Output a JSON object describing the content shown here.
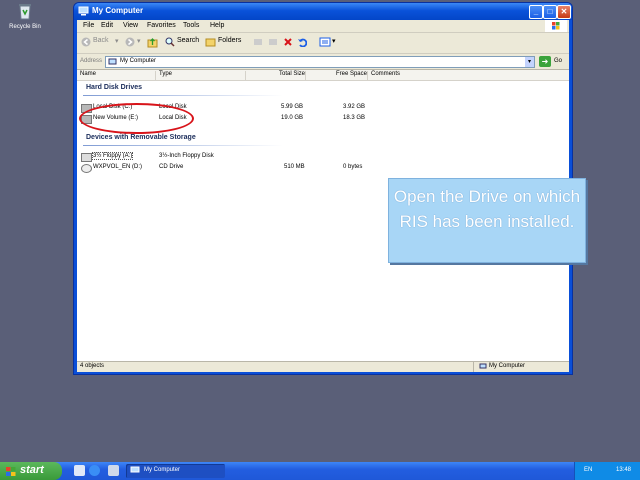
{
  "desktop": {
    "recycle_bin_label": "Recycle Bin"
  },
  "window": {
    "title": "My Computer",
    "controls": {
      "minimize": "_",
      "maximize": "□",
      "close": "✕"
    },
    "menu": [
      "File",
      "Edit",
      "View",
      "Favorites",
      "Tools",
      "Help"
    ],
    "toolbar": {
      "back": "Back",
      "search": "Search",
      "folders": "Folders"
    },
    "address": {
      "label": "Address",
      "value": "My Computer",
      "go": "Go"
    },
    "columns": {
      "name": "Name",
      "type": "Type",
      "total": "Total Size",
      "free": "Free Space",
      "comments": "Comments"
    },
    "groups": {
      "hard": "Hard Disk Drives",
      "removable": "Devices with Removable Storage"
    },
    "drives": [
      {
        "name": "Local Disk (C:)",
        "type": "Local Disk",
        "total": "5.99 GB",
        "free": "3.92 GB"
      },
      {
        "name": "New Volume (E:)",
        "type": "Local Disk",
        "total": "19.0 GB",
        "free": "18.3 GB"
      }
    ],
    "removable": [
      {
        "name": "3½ Floppy (A:)",
        "type": "3½-Inch Floppy Disk",
        "total": "",
        "free": ""
      },
      {
        "name": "WXPVOL_EN (D:)",
        "type": "CD Drive",
        "total": "510 MB",
        "free": "0 bytes"
      }
    ],
    "status": {
      "objects": "4 objects",
      "location": "My Computer"
    }
  },
  "callout": {
    "text": "Open the Drive on which RIS has been installed."
  },
  "taskbar": {
    "start": "start",
    "task": "My Computer",
    "lang": "EN",
    "time": "13:48"
  },
  "colors": {
    "xp_blue": "#0a52d9",
    "highlight": "#d8141a",
    "callout_bg": "#a8d6f6"
  }
}
